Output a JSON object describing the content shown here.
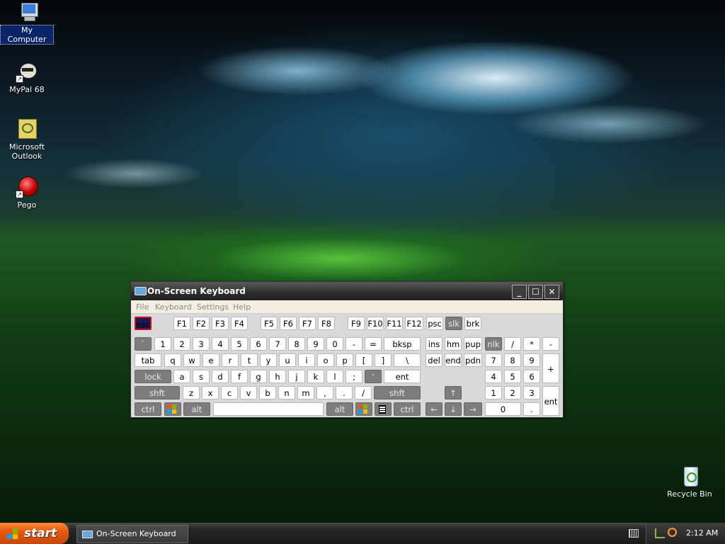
{
  "desktop": {
    "icons": [
      {
        "label": "My Computer",
        "icon": "computer-icon"
      },
      {
        "label": "MyPal 68",
        "icon": "mypal-icon"
      },
      {
        "label": "Microsoft Outlook",
        "icon": "outlook-icon"
      },
      {
        "label": "Pego",
        "icon": "pego-icon"
      },
      {
        "label": "Recycle Bin",
        "icon": "recycle-bin-icon"
      }
    ]
  },
  "osk": {
    "title": "On-Screen Keyboard",
    "menu": [
      "File",
      "Keyboard",
      "Settings",
      "Help"
    ],
    "keys": {
      "esc": "esc",
      "fkeys": [
        "F1",
        "F2",
        "F3",
        "F4",
        "F5",
        "F6",
        "F7",
        "F8",
        "F9",
        "F10",
        "F11",
        "F12"
      ],
      "psc": "psc",
      "slk": "slk",
      "brk": "brk",
      "row_num": [
        "`",
        "1",
        "2",
        "3",
        "4",
        "5",
        "6",
        "7",
        "8",
        "9",
        "0",
        "-",
        "="
      ],
      "bksp": "bksp",
      "tab": "tab",
      "row_q": [
        "q",
        "w",
        "e",
        "r",
        "t",
        "y",
        "u",
        "i",
        "o",
        "p",
        "[",
        "]",
        "\\"
      ],
      "lock": "lock",
      "row_a": [
        "a",
        "s",
        "d",
        "f",
        "g",
        "h",
        "j",
        "k",
        "l",
        ";",
        "'"
      ],
      "ent": "ent",
      "shft": "shft",
      "row_z": [
        "z",
        "x",
        "c",
        "v",
        "b",
        "n",
        "m",
        ",",
        ".",
        "/"
      ],
      "ctrl": "ctrl",
      "alt": "alt",
      "ins": "ins",
      "hm": "hm",
      "pup": "pup",
      "del": "del",
      "end": "end",
      "pdn": "pdn",
      "arrow_up": "↑",
      "arrow_left": "←",
      "arrow_down": "↓",
      "arrow_right": "→",
      "numpad_top": [
        "nlk",
        "/",
        "*",
        "-"
      ],
      "numpad_row1": [
        "7",
        "8",
        "9"
      ],
      "numpad_plus": "+",
      "numpad_row2": [
        "4",
        "5",
        "6"
      ],
      "numpad_row3": [
        "1",
        "2",
        "3"
      ],
      "numpad_ent": "ent",
      "numpad_0": "0",
      "numpad_dot": "."
    }
  },
  "taskbar": {
    "start_label": "start",
    "task_label": "On-Screen Keyboard",
    "clock": "2:12 AM"
  },
  "colors": {
    "start_orange": "#e65b0c",
    "taskbar": "#262626",
    "osk_key_dark": "#7d7d7d",
    "esc_border": "#d01010"
  }
}
